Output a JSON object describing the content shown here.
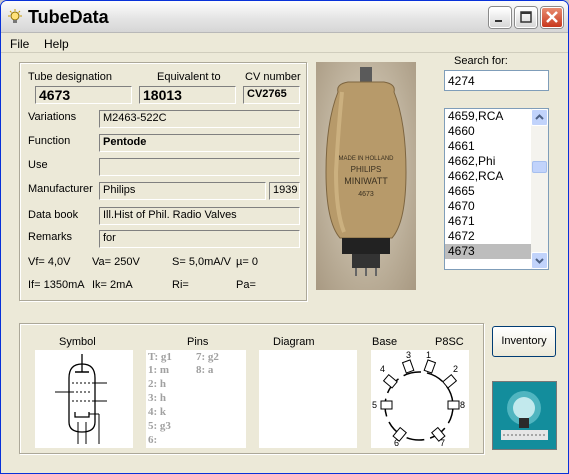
{
  "window": {
    "title": "TubeData"
  },
  "menu": {
    "file": "File",
    "help": "Help"
  },
  "tube": {
    "labels": {
      "designation": "Tube designation",
      "equivalent": "Equivalent to",
      "cv": "CV number",
      "variations": "Variations",
      "function": "Function",
      "use": "Use",
      "manufacturer": "Manufacturer",
      "databook": "Data book",
      "remarks": "Remarks"
    },
    "designation": "4673",
    "equivalent": "18013",
    "cv": "CV2765",
    "variations": "M2463-522C",
    "function": "Pentode",
    "use": "",
    "manufacturer": "Philips",
    "year": "1939",
    "databook": "Ill.Hist of Phil. Radio Valves",
    "remarks": "for",
    "params": {
      "vf": "Vf= 4,0V",
      "va": "Va= 250V",
      "s": "S= 5,0mA/V",
      "mu": "µ= 0",
      "if": "If= 1350mA",
      "ik": "Ik= 2mA",
      "ri": "Ri=",
      "pa": "Pa="
    }
  },
  "search": {
    "label": "Search for:",
    "value": "4274",
    "results": [
      "4659,RCA",
      "4660",
      "4661",
      "4662,Phi",
      "4662,RCA",
      "4665",
      "4670",
      "4671",
      "4672",
      "4673"
    ],
    "selected": "4673"
  },
  "bottom": {
    "symbol_label": "Symbol",
    "pins_label": "Pins",
    "diagram_label": "Diagram",
    "base_label": "Base",
    "base_type": "P8SC",
    "pins_col1": [
      "T: g1",
      "1: m",
      "2: h",
      "3: h",
      "4: k",
      "5: g3",
      "6:"
    ],
    "pins_col2": [
      "7: g2",
      "8: a"
    ],
    "base_pin_numbers": [
      "1",
      "2",
      "3",
      "4",
      "5",
      "6",
      "7",
      "8"
    ]
  },
  "buttons": {
    "inventory": "Inventory"
  },
  "colors": {
    "title_bar": "#e3e3e3",
    "window_bg": "#ece9d8",
    "close_red": "#c8381d",
    "list_selection": "#bdbdbd",
    "logo_teal": "#0f8a9a"
  },
  "icons": {
    "app": "lamp-icon",
    "minimize": "minimize-icon",
    "maximize": "maximize-icon",
    "close": "close-icon",
    "scroll_up": "arrow-up-icon",
    "scroll_down": "arrow-down-icon"
  }
}
